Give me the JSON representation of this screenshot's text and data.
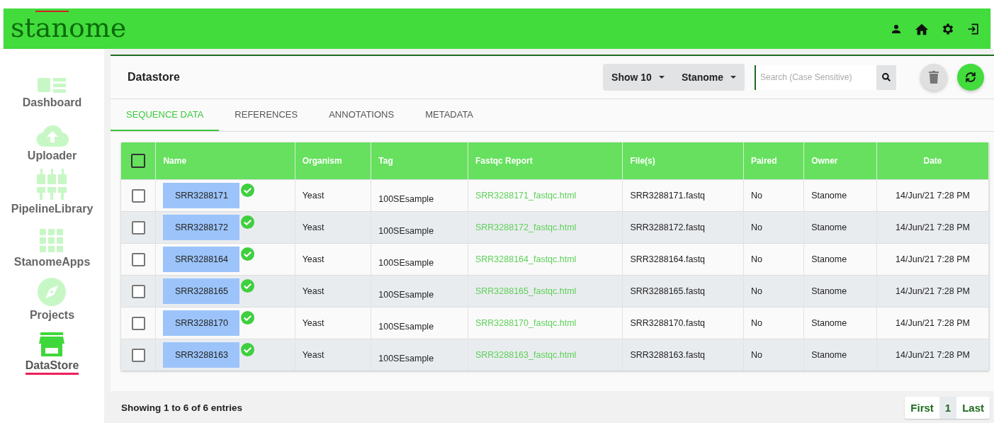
{
  "header": {
    "logo": "stanome"
  },
  "sidebar": {
    "items": [
      {
        "label": "Dashboard",
        "kind": "dashboard",
        "selected": false
      },
      {
        "label": "Uploader",
        "kind": "upload",
        "selected": false
      },
      {
        "label": "PipelineLibrary",
        "kind": "pipeline",
        "selected": false
      },
      {
        "label": "StanomeApps",
        "kind": "apps",
        "selected": false
      },
      {
        "label": "Projects",
        "kind": "compass",
        "selected": false
      },
      {
        "label": "DataStore",
        "kind": "store",
        "selected": true
      }
    ]
  },
  "panel": {
    "title": "Datastore",
    "show_menu": "Show 10",
    "owner_menu": "Stanome",
    "search": {
      "placeholder": "Search (Case Sensitive)"
    }
  },
  "tabs": [
    {
      "label": "SEQUENCE DATA",
      "selected": true
    },
    {
      "label": "REFERENCES",
      "selected": false
    },
    {
      "label": "ANNOTATIONS",
      "selected": false
    },
    {
      "label": "METADATA",
      "selected": false
    }
  ],
  "table": {
    "all_checked": false,
    "columns": [
      "Name",
      "Organism",
      "Tag",
      "Fastqc Report",
      "File(s)",
      "Paired",
      "Owner",
      "Date"
    ],
    "rows": [
      {
        "checked": false,
        "name": "SRR3288171",
        "verified": true,
        "organism": "Yeast",
        "tag": "100SEsample",
        "report": "SRR3288171_fastqc.html",
        "file": "SRR3288171.fastq",
        "paired": "No",
        "owner": "Stanome",
        "date": "14/Jun/21 7:28 PM"
      },
      {
        "checked": false,
        "name": "SRR3288172",
        "verified": true,
        "organism": "Yeast",
        "tag": "100SEsample",
        "report": "SRR3288172_fastqc.html",
        "file": "SRR3288172.fastq",
        "paired": "No",
        "owner": "Stanome",
        "date": "14/Jun/21 7:28 PM"
      },
      {
        "checked": false,
        "name": "SRR3288164",
        "verified": true,
        "organism": "Yeast",
        "tag": "100SEsample",
        "report": "SRR3288164_fastqc.html",
        "file": "SRR3288164.fastq",
        "paired": "No",
        "owner": "Stanome",
        "date": "14/Jun/21 7:28 PM"
      },
      {
        "checked": false,
        "name": "SRR3288165",
        "verified": true,
        "organism": "Yeast",
        "tag": "100SEsample",
        "report": "SRR3288165_fastqc.html",
        "file": "SRR3288165.fastq",
        "paired": "No",
        "owner": "Stanome",
        "date": "14/Jun/21 7:28 PM"
      },
      {
        "checked": false,
        "name": "SRR3288170",
        "verified": true,
        "organism": "Yeast",
        "tag": "100SEsample",
        "report": "SRR3288170_fastqc.html",
        "file": "SRR3288170.fastq",
        "paired": "No",
        "owner": "Stanome",
        "date": "14/Jun/21 7:28 PM"
      },
      {
        "checked": false,
        "name": "SRR3288163",
        "verified": true,
        "organism": "Yeast",
        "tag": "100SEsample",
        "report": "SRR3288163_fastqc.html",
        "file": "SRR3288163.fastq",
        "paired": "No",
        "owner": "Stanome",
        "date": "14/Jun/21 7:28 PM"
      }
    ]
  },
  "footer": {
    "info": "Showing 1 to 6 of 6 entries",
    "pages": [
      {
        "label": "First",
        "selected": false
      },
      {
        "label": "1",
        "selected": true
      },
      {
        "label": "Last",
        "selected": false
      }
    ]
  }
}
